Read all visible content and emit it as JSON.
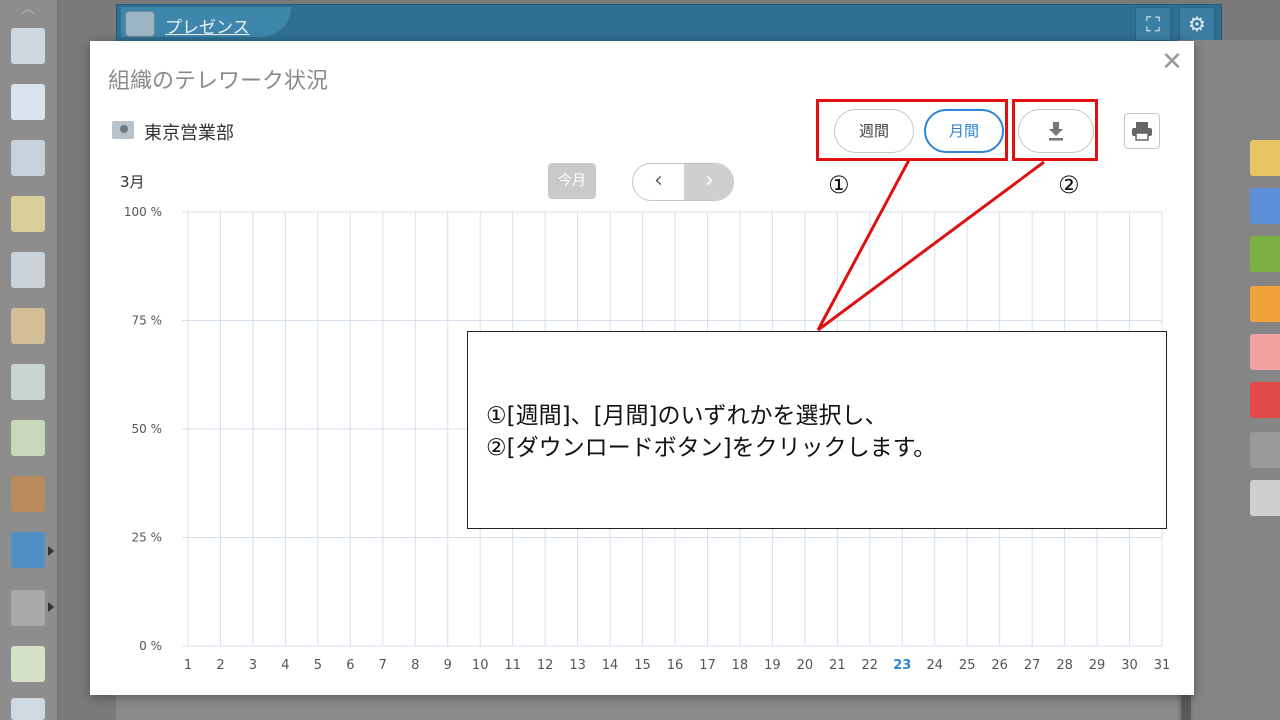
{
  "portal": {
    "title": "プレゼンス"
  },
  "modal": {
    "title": "組織のテレワーク状況",
    "department": "東京営業部",
    "period_buttons": {
      "week": "週間",
      "month": "月間",
      "selected": "month"
    },
    "download_icon": "download-icon",
    "print_icon": "print-icon",
    "month_label": "3月",
    "this_month_label": "今月",
    "prev_icon": "chevron-left-icon",
    "next_icon": "chevron-right-icon",
    "close_icon": "close-icon"
  },
  "annotations": {
    "marker_1": "①",
    "marker_2": "②",
    "note_line_1": "①[週間]、[月間]のいずれかを選択し、",
    "note_line_2": "②[ダウンロードボタン]をクリックします。",
    "highlight_color": "#e01010"
  },
  "chart_data": {
    "type": "bar",
    "categories": [
      "1",
      "2",
      "3",
      "4",
      "5",
      "6",
      "7",
      "8",
      "9",
      "10",
      "11",
      "12",
      "13",
      "14",
      "15",
      "16",
      "17",
      "18",
      "19",
      "20",
      "21",
      "22",
      "23",
      "24",
      "25",
      "26",
      "27",
      "28",
      "29",
      "30",
      "31"
    ],
    "highlight_category": "23",
    "highlight_color": "#2f86d6",
    "y_ticks": [
      "100 %",
      "75 %",
      "50 %",
      "25 %",
      "0 %"
    ],
    "ylim": [
      0,
      100
    ],
    "grid": true
  },
  "colors": {
    "accent": "#2f86d6",
    "grid": "#d5e1ec"
  }
}
